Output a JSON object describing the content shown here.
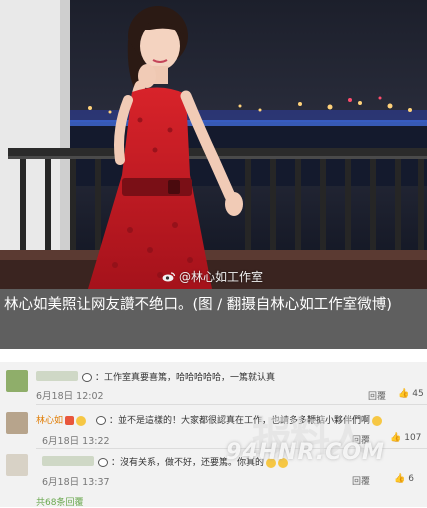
{
  "photo": {
    "alt_subject": "woman in red dress on balcony",
    "weibo_watermark": "@林心如工作室"
  },
  "caption": {
    "text": "林心如美照让网友讚不绝口。(图 / 翻摄自林心如工作室微博)"
  },
  "comments": [
    {
      "text": "：工作室真要喜篤，哈哈哈哈哈，一篤就认真",
      "date": "6月18日 12:02",
      "reply_label": "回覆",
      "like_count": "45"
    },
    {
      "name": "林心如",
      "text": "：並不是這樣的！大家都很認真在工作，也請多多鞭掂小夥伴們啊",
      "date": "6月18日 13:22",
      "reply_label": "回覆",
      "like_count": "107"
    },
    {
      "text": "：沒有关系，做不好，还要篤。你真的",
      "date": "6月18日 13:37",
      "reply_label": "回覆",
      "like_count": "6"
    }
  ],
  "more_replies": "共68条回覆",
  "site_watermark": "94HNR.COM",
  "site_watermark_logo": "报料人"
}
